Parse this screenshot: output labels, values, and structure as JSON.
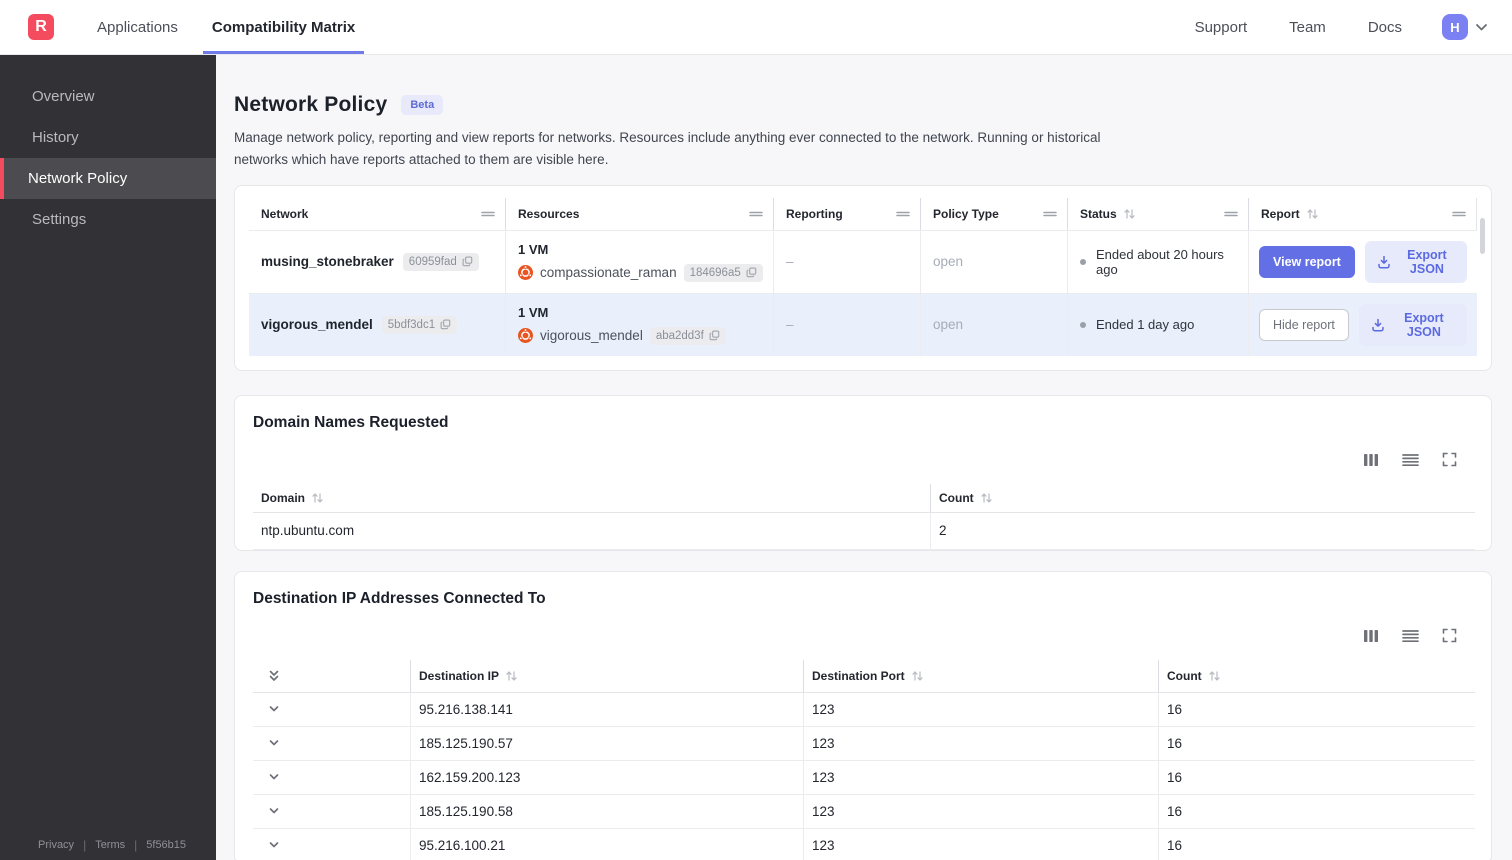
{
  "topnav": {
    "logo_letter": "R",
    "tabs": [
      {
        "label": "Applications"
      },
      {
        "label": "Compatibility Matrix",
        "active": true
      }
    ],
    "links": [
      "Support",
      "Team",
      "Docs"
    ],
    "avatar_initial": "H"
  },
  "sidebar": {
    "items": [
      {
        "label": "Overview"
      },
      {
        "label": "History"
      },
      {
        "label": "Network Policy",
        "active": true
      },
      {
        "label": "Settings"
      }
    ],
    "footer": [
      "Privacy",
      "Terms",
      "5f56b15"
    ]
  },
  "page": {
    "title": "Network Policy",
    "badge": "Beta",
    "description": "Manage network policy, reporting and view reports for networks. Resources include anything ever connected to the network. Running or historical networks which have reports attached to them are visible here."
  },
  "networks_table": {
    "columns": [
      "Network",
      "Resources",
      "Reporting",
      "Policy Type",
      "Status",
      "Report"
    ],
    "rows": [
      {
        "name": "musing_stonebraker",
        "id": "60959fad",
        "vm_count": "1 VM",
        "resource_name": "compassionate_raman",
        "resource_id": "184696a5",
        "reporting": "–",
        "policy_type": "open",
        "status": "Ended about 20 hours ago",
        "report_label": "View report",
        "report_variant": "btn-primary",
        "export_label": "Export JSON",
        "row_class": ""
      },
      {
        "name": "vigorous_mendel",
        "id": "5bdf3dc1",
        "vm_count": "1 VM",
        "resource_name": "vigorous_mendel",
        "resource_id": "aba2dd3f",
        "reporting": "–",
        "policy_type": "open",
        "status": "Ended 1 day ago",
        "report_label": "Hide report",
        "report_variant": "btn-outline",
        "export_label": "Export JSON",
        "row_class": "highlighted"
      }
    ]
  },
  "domains_card": {
    "title": "Domain Names Requested",
    "columns": [
      "Domain",
      "Count"
    ],
    "rows": [
      {
        "domain": "ntp.ubuntu.com",
        "count": "2"
      }
    ]
  },
  "destinations_card": {
    "title": "Destination IP Addresses Connected To",
    "columns": [
      "Destination IP",
      "Destination Port",
      "Count"
    ],
    "rows": [
      {
        "ip": "95.216.138.141",
        "port": "123",
        "count": "16"
      },
      {
        "ip": "185.125.190.57",
        "port": "123",
        "count": "16"
      },
      {
        "ip": "162.159.200.123",
        "port": "123",
        "count": "16"
      },
      {
        "ip": "185.125.190.58",
        "port": "123",
        "count": "16"
      },
      {
        "ip": "95.216.100.21",
        "port": "123",
        "count": "16"
      }
    ]
  },
  "colors": {
    "brand_red": "#f54b5e",
    "accent_indigo": "#6370e5",
    "accent_indigo_light": "#e7eafb",
    "active_tab_underline": "#6e7be8",
    "avatar_bg": "#7b80f2",
    "sidebar_bg": "#323236",
    "sidebar_active_bg": "#4b4b50",
    "row_highlight": "#e9f0fb",
    "beta_badge_bg": "#e8e9fb",
    "beta_badge_text": "#5c6bd6",
    "ubuntu_orange": "#e95420"
  },
  "icons": {
    "logo": "app-logo",
    "avatar_menu": "chevron-down",
    "column_handle": "drag-handle",
    "sort": "sort-arrows",
    "copy": "copy",
    "export": "download",
    "toolbar": [
      "columns",
      "rows",
      "fullscreen"
    ],
    "expand_all": "double-chevron-down",
    "expand_row": "chevron-down",
    "resource_os": "ubuntu-logo",
    "status": "dot"
  }
}
